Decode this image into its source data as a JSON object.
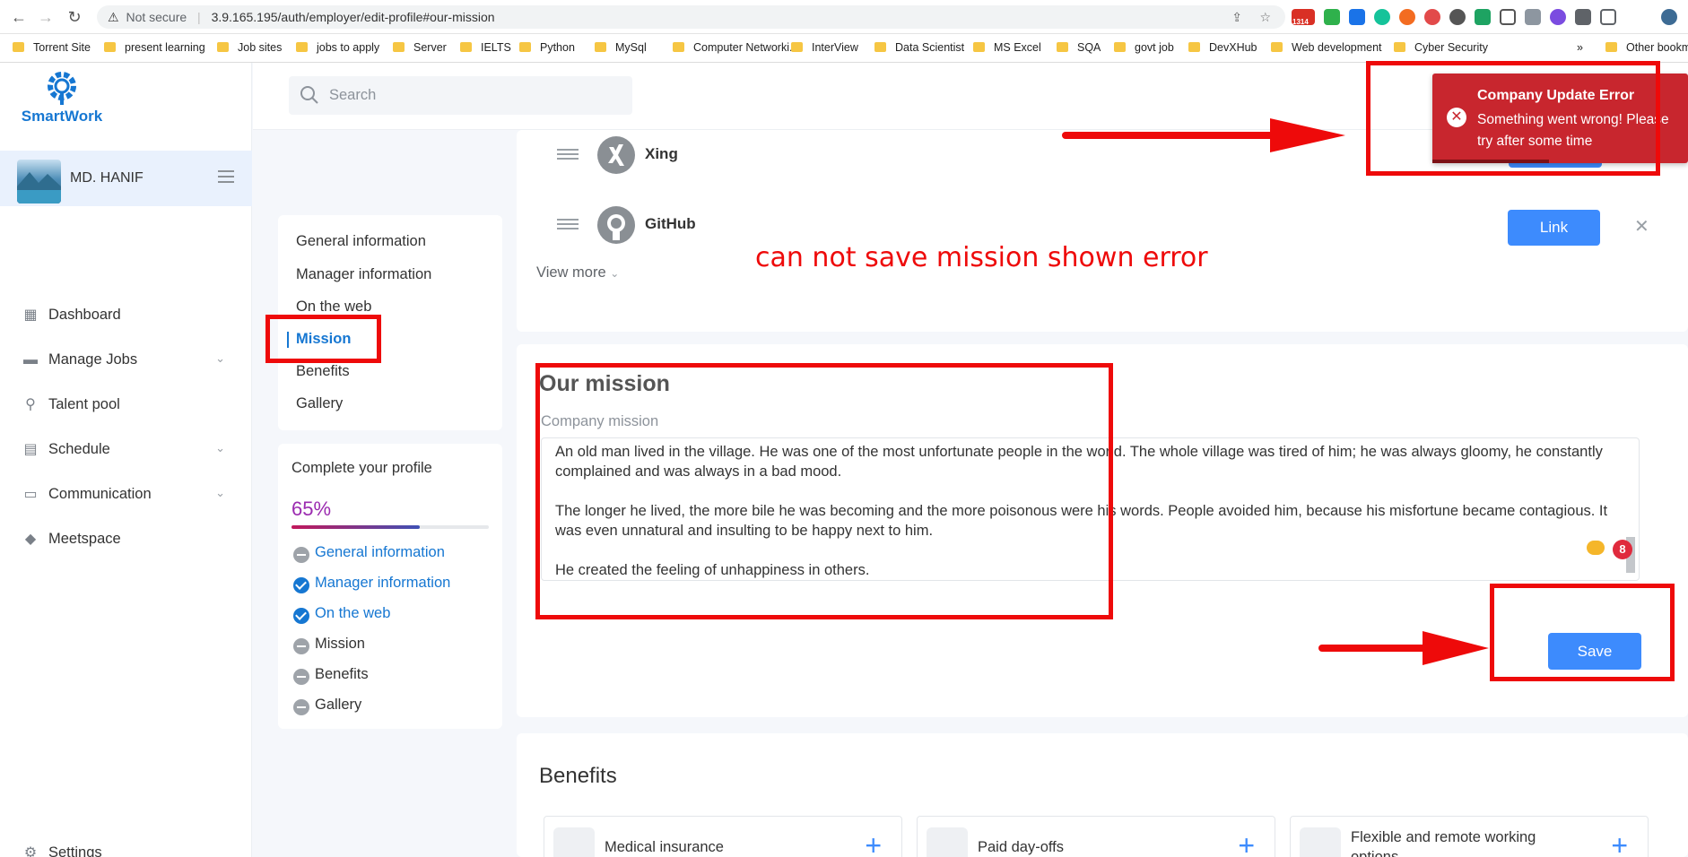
{
  "browser": {
    "security_label": "Not secure",
    "url": "3.9.165.195/auth/employer/edit-profile#our-mission",
    "gmail_badge": "1314",
    "bookmarks": [
      "Torrent Site",
      "present learning",
      "Job sites",
      "jobs to apply",
      "Server",
      "IELTS",
      "Python",
      "MySql",
      "Computer Networki...",
      "InterView",
      "Data Scientist",
      "MS Excel",
      "SQA",
      "govt job",
      "DevXHub",
      "Web development",
      "Cyber Security"
    ],
    "more_bookmarks": "»",
    "other_bookmarks": "Other bookm"
  },
  "sidebar": {
    "logo_text": "SmartWork",
    "user_name": "MD. HANIF",
    "items": [
      {
        "label": "Dashboard",
        "icon": "dashboard-icon",
        "has_chevron": false
      },
      {
        "label": "Manage Jobs",
        "icon": "briefcase-icon",
        "has_chevron": true
      },
      {
        "label": "Talent pool",
        "icon": "person-search-icon",
        "has_chevron": false
      },
      {
        "label": "Schedule",
        "icon": "calendar-icon",
        "has_chevron": true
      },
      {
        "label": "Communication",
        "icon": "chat-icon",
        "has_chevron": true
      },
      {
        "label": "Meetspace",
        "icon": "meetspace-icon",
        "has_chevron": false
      }
    ],
    "settings_label": "Settings"
  },
  "header": {
    "search_placeholder": "Search"
  },
  "section_nav": {
    "items": [
      "General information",
      "Manager information",
      "On the web",
      "Mission",
      "Benefits",
      "Gallery"
    ],
    "active": "Mission"
  },
  "profile_completion": {
    "title": "Complete your profile",
    "percent_label": "65%",
    "percent": 65,
    "items": [
      {
        "label": "General information",
        "status": "todo",
        "link": true
      },
      {
        "label": "Manager information",
        "status": "done",
        "link": true
      },
      {
        "label": "On the web",
        "status": "done",
        "link": true
      },
      {
        "label": "Mission",
        "status": "todo",
        "link": false
      },
      {
        "label": "Benefits",
        "status": "todo",
        "link": false
      },
      {
        "label": "Gallery",
        "status": "todo",
        "link": false
      }
    ]
  },
  "on_the_web": {
    "rows": [
      {
        "name": "Xing",
        "icon": "xing-icon"
      },
      {
        "name": "GitHub",
        "icon": "github-icon",
        "button": "Link",
        "close": "✕"
      }
    ],
    "view_more": "View more"
  },
  "mission": {
    "title": "Our mission",
    "label": "Company mission",
    "paragraphs": [
      "An old man lived in the village. He was one of the most unfortunate people in the world. The whole village was tired of him; he was always gloomy, he constantly complained and was always in a bad mood.",
      "The longer he lived, the more bile he was becoming and the more poisonous were his words. People avoided him, because his misfortune became contagious. It was even unnatural and insulting to be happy next to him.",
      "He created the feeling of unhappiness in others."
    ],
    "extension_badge": "8",
    "save_label": "Save"
  },
  "benefits": {
    "title": "Benefits",
    "items": [
      {
        "label": "Medical insurance",
        "icon": "shield-plus-icon"
      },
      {
        "label": "Paid day-offs",
        "icon": "sleep-face-icon"
      },
      {
        "label": "Flexible and remote working options",
        "icon": "home-icon"
      }
    ]
  },
  "toast": {
    "title": "Company Update Error",
    "message": "Something went wrong! Please try after some time"
  },
  "annotation": {
    "text": "can not save mission shown error"
  },
  "colors": {
    "accent": "#3d8bfd",
    "annotation": "#ee0a0a",
    "error": "#c8262e",
    "brand": "#1677d2"
  }
}
